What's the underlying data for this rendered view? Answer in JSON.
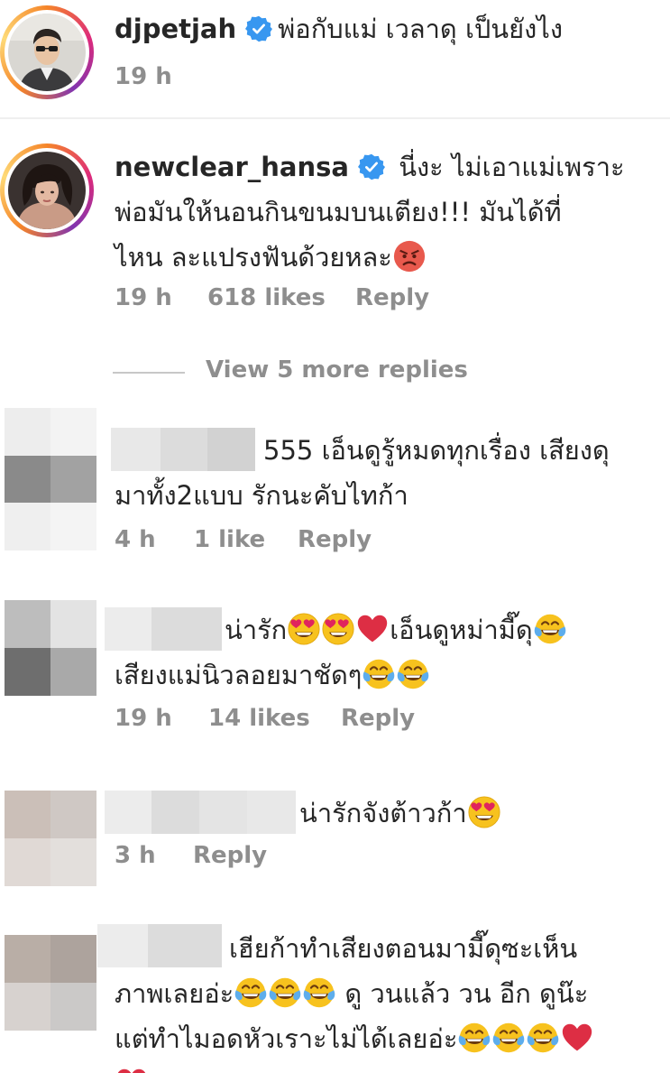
{
  "comments": [
    {
      "username": "djpetjah",
      "text": "พ่อกับแม่ เวลาดุ  เป็นยังไง",
      "time": "19 h"
    },
    {
      "username": "newclear_hansa",
      "line1": "นี่งะ ไม่เอาแม่เพราะ",
      "line2": "พ่อมันให้นอนกินขนมบนเตียง!!! มันได้ที่",
      "line3": "ไหน ละแปรงฟันด้วยหละ",
      "time": "19 h",
      "likes": "618 likes",
      "reply": "Reply"
    }
  ],
  "view_more": "View 5 more replies",
  "replies": [
    {
      "line1": "555 เอ็นดูรู้หมดทุกเรื่อง เสียงดุ",
      "line2": "มาทั้ง2แบบ รักนะคับไทก้า",
      "time": "4 h",
      "likes": "1 like",
      "reply": "Reply"
    },
    {
      "line1a": "น่ารัก",
      "line1b": "เอ็นดูหม่ามี๊ดุ",
      "line2": "เสียงแม่นิวลอยมาชัดๆ",
      "time": "19 h",
      "likes": "14 likes",
      "reply": "Reply"
    },
    {
      "line1": "น่ารักจังต้าวก้า",
      "time": "3 h",
      "reply": "Reply"
    },
    {
      "line1": "เฮียก้าทำเสียงตอนมามี๊ดุซะเห็น",
      "line2a": "ภาพเลยอ่ะ",
      "line2b": "ดู วนแล้ว วน อีก ดูน๊ะ",
      "line3": "แต่ทำไมอดหัวเราะไม่ได้เลยอ่ะ"
    }
  ],
  "icons": {
    "verified": "verified-badge-icon",
    "heart_eyes": "heart-eyes-emoji",
    "red_heart": "red-heart-emoji",
    "tears_of_joy": "tears-of-joy-emoji",
    "angry": "angry-face-emoji"
  },
  "colors": {
    "verified_blue": "#3897f0",
    "muted_text": "#8e8e8e"
  }
}
